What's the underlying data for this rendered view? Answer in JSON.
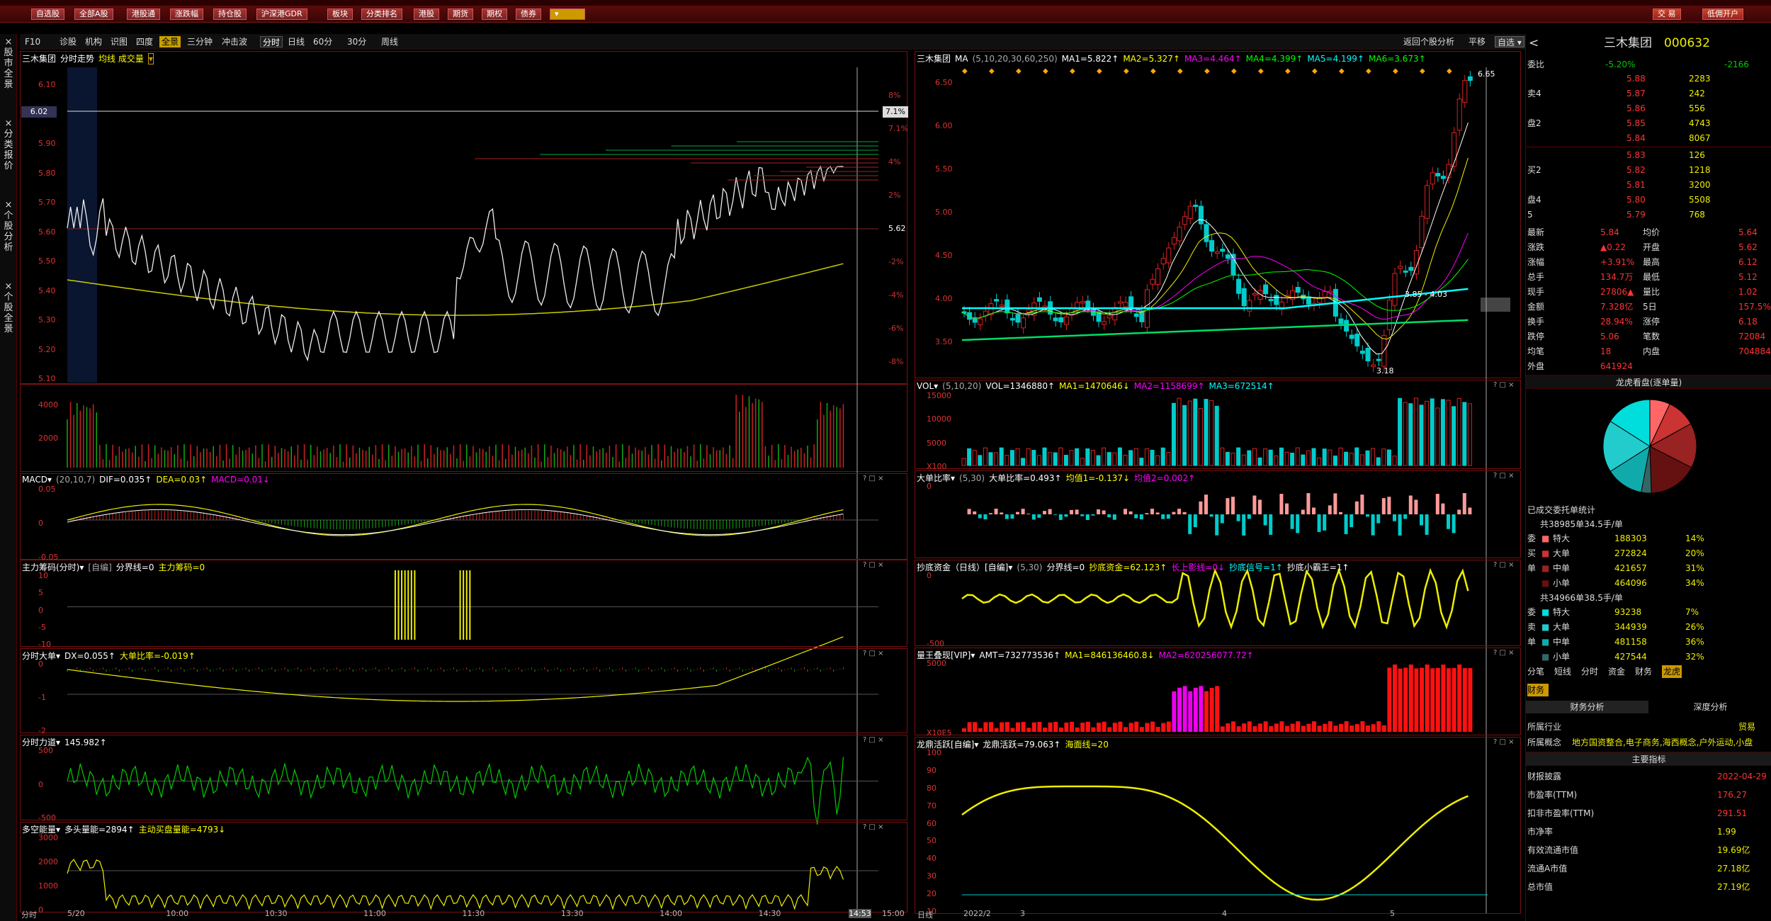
{
  "toolbar": {
    "buttons": [
      "自选股",
      "全部A股",
      "港股通",
      "涨跌幅",
      "持仓股",
      "沪深港GDR",
      "板块",
      "分类排名",
      "港股",
      "期货",
      "期权",
      "债券"
    ],
    "trade": "交 易",
    "open_account": "低佣开户"
  },
  "left_strip": {
    "items": [
      "股市全景",
      "分类报价",
      "个股分析",
      "个股全景"
    ]
  },
  "subtabs": {
    "left": [
      "F10",
      "诊股",
      "机构",
      "识图",
      "四度",
      "全景",
      "三分钟",
      "冲击波"
    ],
    "period": [
      "分时",
      "日线",
      "60分",
      "30分",
      "周线"
    ],
    "right": [
      "返回个股分析",
      "平移",
      "自选"
    ]
  },
  "intraday": {
    "title": "三木集团",
    "subtitle": "分时走势",
    "mode": "均线 成交量",
    "price_ticks": [
      "6.10",
      "6.02",
      "5.90",
      "5.80",
      "5.70",
      "5.60",
      "5.50",
      "5.40",
      "5.30",
      "5.20",
      "5.10"
    ],
    "pct_ticks": [
      "8%",
      "7.1%",
      "4%",
      "2%",
      "5.62",
      "-2%",
      "-4%",
      "-6%",
      "-8%"
    ],
    "price_tag": "6.02",
    "pct_tag": "7.1%",
    "vol_ticks": [
      "4000",
      "2000"
    ],
    "time_ticks": [
      "分时",
      "5/20",
      "10:00",
      "10:30",
      "11:00",
      "11:30",
      "13:30",
      "14:00",
      "14:30",
      "14:53",
      "15:00"
    ]
  },
  "subpanels": [
    {
      "name": "MACD",
      "params": "(20,10,7)",
      "vals": [
        "DIF=0.035↑",
        "DEA=0.03↑",
        "MACD=0.01↓"
      ],
      "ticks": [
        "0.05",
        "0",
        "-0.05"
      ]
    },
    {
      "name": "主力筹码(分时)",
      "params": "[自编]",
      "vals": [
        "分界线=0",
        "主力筹码=0"
      ],
      "ticks": [
        "10",
        "5",
        "0",
        "-5",
        "-10"
      ]
    },
    {
      "name": "分时大单",
      "params": "",
      "vals": [
        "DX=0.055↑",
        "大单比率=-0.019↑"
      ],
      "ticks": [
        "0",
        "-1",
        "-2"
      ]
    },
    {
      "name": "分时力道",
      "params": "",
      "vals": [
        "145.982↑"
      ],
      "ticks": [
        "500",
        "0",
        "-500"
      ]
    },
    {
      "name": "多空能量",
      "params": "",
      "vals": [
        "多头量能=2894↑",
        "主动买盘量能=4793↓"
      ],
      "ticks": [
        "3000",
        "2000",
        "1000",
        "0"
      ]
    }
  ],
  "kline": {
    "title": "三木集团",
    "ma_label": "MA",
    "ma_params": "(5,10,20,30,60,250)",
    "ma_vals": [
      "MA1=5.822↑",
      "MA2=5.327↑",
      "MA3=4.464↑",
      "MA4=4.399↑",
      "MA5=4.199↑",
      "MA6=3.673↑"
    ],
    "price_ticks": [
      "6.50",
      "6.00",
      "5.50",
      "5.00",
      "4.50",
      "4.00",
      "3.50"
    ],
    "high_label": "6.65",
    "low_label": "3.18",
    "range_label": "3.85 - 4.03",
    "x_ticks": [
      "日线",
      "2022/2",
      "3",
      "4",
      "5"
    ]
  },
  "kpanels": [
    {
      "name": "VOL",
      "params": "(5,10,20)",
      "vals": [
        "VOL=1346880↑",
        "MA1=1470646↓",
        "MA2=1158699↑",
        "MA3=672514↑"
      ],
      "ticks": [
        "15000",
        "10000",
        "5000",
        "X100"
      ]
    },
    {
      "name": "大单比率",
      "params": "(5,30)",
      "vals": [
        "大单比率=0.493↑",
        "均值1=-0.137↓",
        "均值2=0.002↑"
      ],
      "ticks": [
        "0"
      ]
    },
    {
      "name": "抄底资金（日线）[自编]",
      "params": "(5,30)",
      "vals": [
        "分界线=0",
        "抄底资金=62.123↑",
        "长上影线=0↓",
        "抄底信号=1↑",
        "抄底小霸王=1↑"
      ],
      "ticks": [
        "0",
        "-500"
      ]
    },
    {
      "name": "量王叠现[VIP]",
      "params": "",
      "vals": [
        "AMT=732773536↑",
        "MA1=846136460.8↓",
        "MA2=620256077.72↑"
      ],
      "ticks": [
        "5000",
        "X10E5"
      ]
    },
    {
      "name": "龙鼎活跃[自编]",
      "params": "",
      "vals": [
        "龙鼎活跃=79.063↑",
        "海面线=20"
      ],
      "ticks": [
        "100",
        "90",
        "80",
        "70",
        "60",
        "50",
        "40",
        "30",
        "20",
        "10"
      ]
    }
  ],
  "quote": {
    "name": "三木集团",
    "code": "000632",
    "weibi_label": "委比",
    "weibi": "-5.20%",
    "weicha": "-2166",
    "sells": [
      [
        "",
        "5.88",
        "2283"
      ],
      [
        "卖4",
        "5.87",
        "242"
      ],
      [
        "",
        "5.86",
        "556"
      ],
      [
        "盘2",
        "5.85",
        "4743"
      ],
      [
        "",
        "5.84",
        "8067"
      ]
    ],
    "buys": [
      [
        "",
        "5.83",
        "126"
      ],
      [
        "买2",
        "5.82",
        "1218"
      ],
      [
        "",
        "5.81",
        "3200"
      ],
      [
        "盘4",
        "5.80",
        "5508"
      ],
      [
        "5",
        "5.79",
        "768"
      ]
    ],
    "stats": [
      [
        "最新",
        "5.84",
        "均价",
        "5.64"
      ],
      [
        "涨跌",
        "▲0.22",
        "开盘",
        "5.62"
      ],
      [
        "涨幅",
        "+3.91%",
        "最高",
        "6.12"
      ],
      [
        "总手",
        "134.7万",
        "最低",
        "5.12"
      ],
      [
        "现手",
        "27806▲",
        "量比",
        "1.02"
      ],
      [
        "金额",
        "7.328亿",
        "5日",
        "157.5%"
      ],
      [
        "换手",
        "28.94%",
        "涨停",
        "6.18"
      ],
      [
        "跌停",
        "5.06",
        "笔数",
        "72084"
      ],
      [
        "均笔",
        "18",
        "内盘",
        "704884"
      ],
      [
        "外盘",
        "641924",
        "",
        " "
      ]
    ],
    "dragon_title": "龙虎看盘(逐单量)",
    "pie_colors": [
      "#f66",
      "#c33",
      "#922",
      "#611",
      "#366",
      "#1aa",
      "#2cc",
      "#0dd"
    ],
    "pie_values": [
      14,
      20,
      31,
      34,
      7,
      26,
      36,
      32
    ],
    "stat_title": "已成交委托单统计",
    "buy_total": "共38985单34.5手/单",
    "sell_total": "共34966单38.5手/单",
    "buy_rows": [
      [
        "委",
        "特大",
        "188303",
        "14%"
      ],
      [
        "买",
        "大单",
        "272824",
        "20%"
      ],
      [
        "单",
        "中单",
        "421657",
        "31%"
      ],
      [
        "",
        "小单",
        "464096",
        "34%"
      ]
    ],
    "sell_rows": [
      [
        "委",
        "特大",
        "93238",
        "7%"
      ],
      [
        "卖",
        "大单",
        "344939",
        "26%"
      ],
      [
        "单",
        "中单",
        "481158",
        "36%"
      ],
      [
        "",
        "小单",
        "427544",
        "32%"
      ]
    ],
    "tabs": [
      "分笔",
      "短线",
      "分时",
      "资金",
      "财务",
      "龙虎"
    ],
    "fin_tab": "财务",
    "fin_tabs": [
      "财务分析",
      "深度分析"
    ],
    "industry_label": "所属行业",
    "industry": "贸易",
    "concept_label": "所属概念",
    "concept": "地方国资整合,电子商务,海西概念,户外运动,小盘",
    "indicator_title": "主要指标",
    "fin_rows": [
      [
        "财报披露",
        "2022-04-29"
      ],
      [
        "市盈率(TTM)",
        "176.27"
      ],
      [
        "扣非市盈率(TTM)",
        "291.51"
      ],
      [
        "市净率",
        "1.99"
      ],
      [
        "有效流通市值",
        "19.69亿"
      ],
      [
        "流通A市值",
        "27.18亿"
      ],
      [
        "总市值",
        "27.19亿"
      ]
    ]
  }
}
